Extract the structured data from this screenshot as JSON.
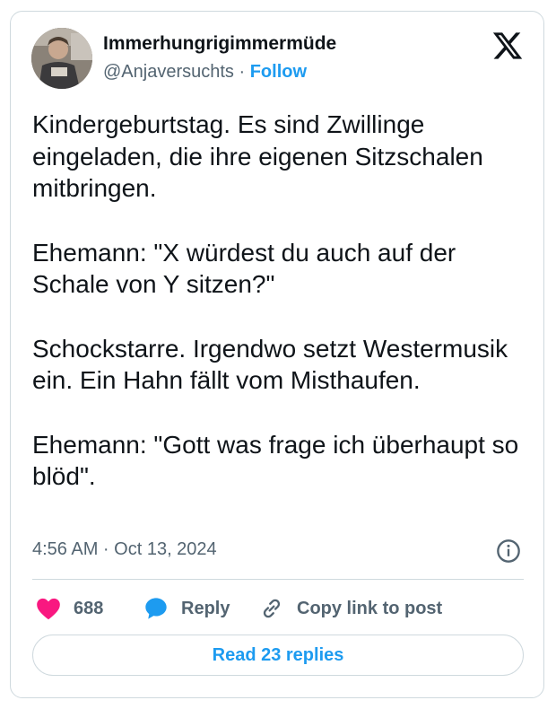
{
  "author": {
    "display_name": "Immerhungrigimmermüde",
    "handle": "@Anjaversuchts",
    "separator": "·",
    "follow_label": "Follow"
  },
  "tweet": {
    "paragraphs": [
      "Kindergeburtstag. Es sind Zwillinge eingeladen, die ihre eigenen Sitzschalen mitbringen.",
      "Ehemann: \"X würdest du auch auf der Schale von Y sitzen?\"",
      "Schockstarre. Irgendwo setzt Westermusik ein. Ein Hahn fällt vom Misthaufen.",
      "Ehemann: \"Gott was frage ich überhaupt so blöd\"."
    ],
    "timestamp": "4:56 AM · Oct 13, 2024"
  },
  "actions": {
    "like_count": "688",
    "reply_label": "Reply",
    "copy_label": "Copy link to post",
    "read_replies_label": "Read 23 replies"
  },
  "colors": {
    "accent": "#1d9bf0",
    "like": "#f91880",
    "text": "#0f1419",
    "muted": "#536471",
    "border": "#cfd9de"
  },
  "icons": [
    "x-logo-icon",
    "info-icon",
    "heart-icon",
    "reply-bubble-icon",
    "link-icon"
  ]
}
